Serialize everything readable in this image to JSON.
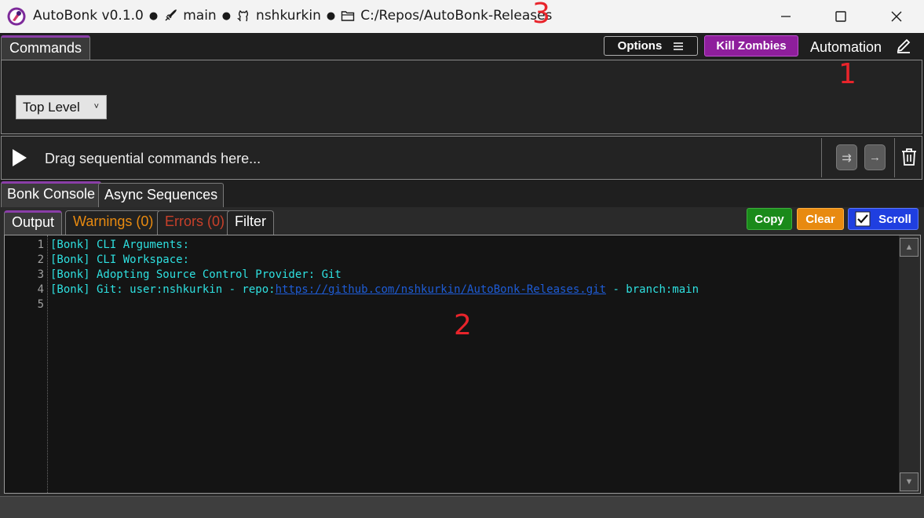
{
  "window": {
    "app_name": "AutoBonk v0.1.0",
    "branch": "main",
    "user": "nshkurkin",
    "path": "C:/Repos/AutoBonk-Releases",
    "separator": "●"
  },
  "annotations": {
    "one": "1",
    "two": "2",
    "three": "3"
  },
  "commands_tab": "Commands",
  "toolbar": {
    "options_label": "Options",
    "kill_label": "Kill Zombies",
    "automation_label": "Automation"
  },
  "level_select": {
    "value": "Top Level",
    "caret": "˅"
  },
  "sequence": {
    "placeholder": "Drag sequential commands here...",
    "parallel_icon": "⇉",
    "next_icon": "→"
  },
  "console_tabs": [
    "Bonk Console",
    "Async Sequences"
  ],
  "output_tabs": {
    "output": "Output",
    "warnings": "Warnings (0)",
    "errors": "Errors (0)",
    "filter": "Filter"
  },
  "output_buttons": {
    "copy": "Copy",
    "clear": "Clear",
    "scroll": "Scroll",
    "scroll_checked": true
  },
  "console_lines": [
    {
      "n": "1",
      "text": "[Bonk] CLI Arguments:"
    },
    {
      "n": "2",
      "text": "[Bonk] CLI Workspace:"
    },
    {
      "n": "3",
      "text": "[Bonk] Adopting Source Control Provider: Git"
    },
    {
      "n": "4",
      "prefix": "[Bonk] Git: user:nshkurkin - repo:",
      "link": "https://github.com/nshkurkin/AutoBonk-Releases.git",
      "suffix": " - branch:main"
    },
    {
      "n": "5",
      "text": ""
    }
  ],
  "colors": {
    "accent_purple": "#8a3ea8",
    "kill_purple": "#8e1e9c",
    "copy_green": "#1a8a1a",
    "clear_orange": "#e88a10",
    "scroll_blue": "#1f3fe0",
    "warnings_orange": "#e88a10",
    "errors_red": "#c8402a",
    "console_cyan": "#2ee0e0"
  },
  "icons": {
    "logo": "app-logo-icon",
    "branch": "rocket-icon",
    "user": "github-octocat-icon",
    "path": "folder-icon",
    "minimize": "minimize-icon",
    "maximize": "maximize-icon",
    "close": "close-icon",
    "options": "menu-lines-icon",
    "automation": "pencil-icon",
    "play": "play-icon",
    "trash": "trash-icon"
  }
}
